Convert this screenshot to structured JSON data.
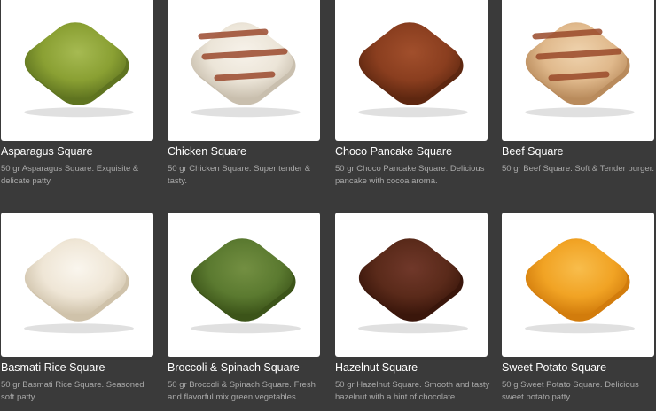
{
  "products": [
    {
      "title": "Asparagus Square",
      "desc": "50 gr Asparagus Square. Exquisite & delicate patty.",
      "color": "#8aa033",
      "shade": "#5f7420",
      "highlight": "#a6ba52",
      "grill": false
    },
    {
      "title": "Chicken Square",
      "desc": "50 gr Chicken Square. Super tender & tasty.",
      "color": "#ece5d8",
      "shade": "#c9bfae",
      "highlight": "#f7f2ea",
      "grill": true,
      "grill_color": "#9b4a2e"
    },
    {
      "title": "Choco Pancake Square",
      "desc": "50 gr Choco Pancake Square. Delicious pancake with cocoa aroma.",
      "color": "#8a3e1f",
      "shade": "#5e2710",
      "highlight": "#a14f2c",
      "grill": false
    },
    {
      "title": "Beef Square",
      "desc": "50 gr Beef Square. Soft & Tender burger.",
      "color": "#e0b98c",
      "shade": "#b98b5c",
      "highlight": "#efd3ae",
      "grill": true,
      "grill_color": "#9a4a2a"
    },
    {
      "title": "Basmati Rice Square",
      "desc": "50 gr Basmati Rice Square. Seasoned soft patty.",
      "color": "#efe6d6",
      "shade": "#cfc2aa",
      "highlight": "#faf6ee",
      "grill": false
    },
    {
      "title": "Broccoli & Spinach Square",
      "desc": "50 gr Broccoli & Spinach Square. Fresh and flavorful mix green vegetables.",
      "color": "#5b7a30",
      "shade": "#3c5419",
      "highlight": "#738f42",
      "grill": false
    },
    {
      "title": "Hazelnut Square",
      "desc": "50 gr Hazelnut Square. Smooth and tasty hazelnut with a hint of chocolate.",
      "color": "#5a2a1a",
      "shade": "#3a160b",
      "highlight": "#70382a",
      "grill": false
    },
    {
      "title": "Sweet Potato Square",
      "desc": "50 g Sweet Potato Square. Delicious sweet potato patty.",
      "color": "#f1a324",
      "shade": "#d27c0c",
      "highlight": "#f8bd4c",
      "grill": false
    }
  ]
}
